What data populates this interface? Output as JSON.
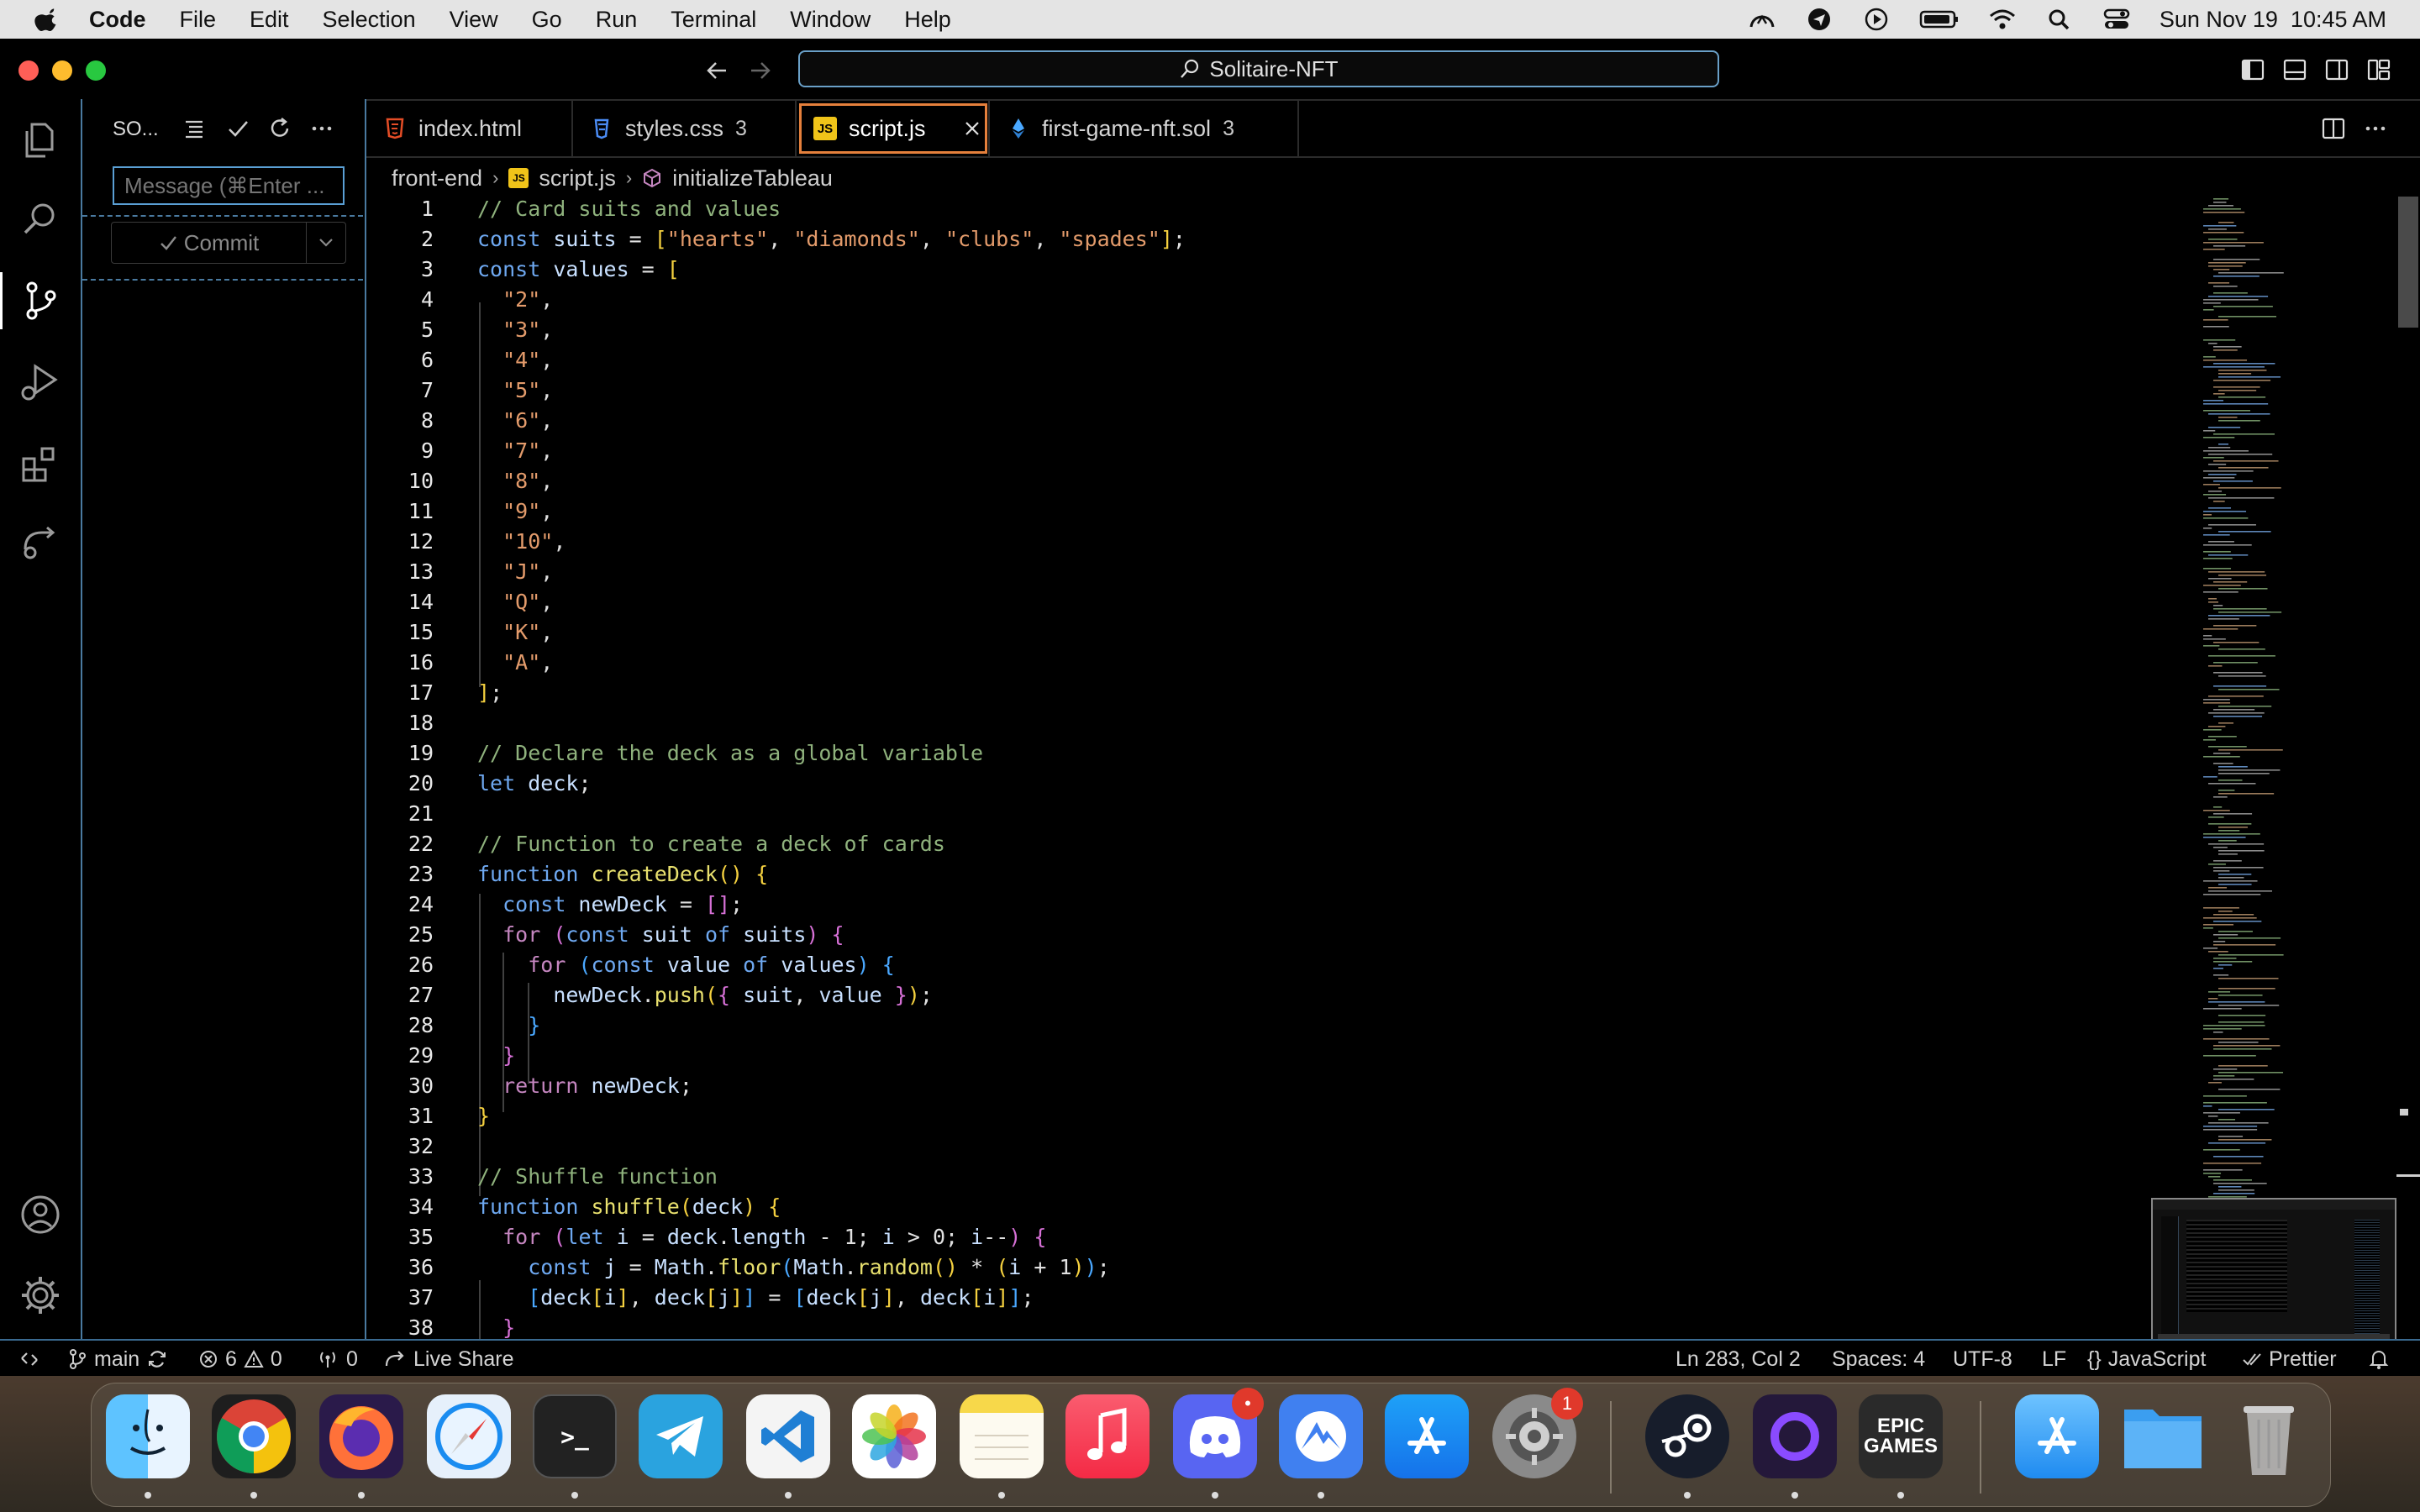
{
  "menubar": {
    "app_name": "Code",
    "items": [
      "File",
      "Edit",
      "Selection",
      "View",
      "Go",
      "Run",
      "Terminal",
      "Window",
      "Help"
    ],
    "clock": "Sun Nov 19  10:45 AM"
  },
  "titlebar": {
    "search_text": "Solitaire-NFT"
  },
  "sidebar": {
    "title": "SO...",
    "message_placeholder": "Message (⌘Enter ...",
    "commit_label": "Commit"
  },
  "tabs": [
    {
      "label": "index.html",
      "badge": ""
    },
    {
      "label": "styles.css",
      "badge": "3"
    },
    {
      "label": "script.js",
      "badge": ""
    },
    {
      "label": "first-game-nft.sol",
      "badge": "3"
    }
  ],
  "breadcrumb": {
    "folder": "front-end",
    "file": "script.js",
    "symbol": "initializeTableau"
  },
  "editor": {
    "line_numbers": [
      "1",
      "2",
      "3",
      "4",
      "5",
      "6",
      "7",
      "8",
      "9",
      "10",
      "11",
      "12",
      "13",
      "14",
      "15",
      "16",
      "17",
      "18",
      "19",
      "20",
      "21",
      "22",
      "23",
      "24",
      "25",
      "26",
      "27",
      "28",
      "29",
      "30",
      "31",
      "32",
      "33",
      "34",
      "35",
      "36",
      "37",
      "38"
    ]
  },
  "statusbar": {
    "branch": "main",
    "errors": "6",
    "warnings": "0",
    "ports": "0",
    "live_share": "Live Share",
    "cursor": "Ln 283, Col 2",
    "spaces": "Spaces: 4",
    "encoding": "UTF-8",
    "eol": "LF",
    "language": "JavaScript",
    "formatter": "Prettier"
  },
  "dock": {
    "badges": {
      "discord": "•",
      "system_settings": "1"
    },
    "epic_label": "EPIC\nGAMES"
  },
  "colors": {
    "accent": "#e5803c",
    "border": "#4a7aa0",
    "bg": "#000000"
  }
}
